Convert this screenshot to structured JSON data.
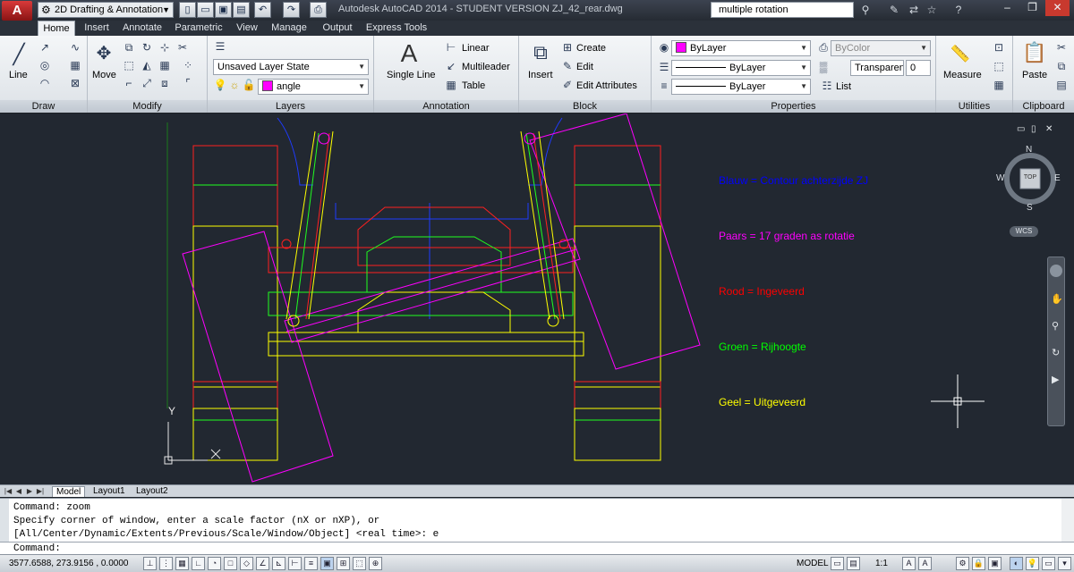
{
  "app": {
    "logo": "A",
    "window_title": "Autodesk AutoCAD 2014 - STUDENT VERSION    ZJ_42_rear.dwg"
  },
  "workspace": {
    "label": "2D Drafting & Annotation"
  },
  "search": {
    "value": "multiple rotation"
  },
  "tabs": [
    "Home",
    "Insert",
    "Annotate",
    "Parametric",
    "View",
    "Manage",
    "Output",
    "Express Tools"
  ],
  "panels": {
    "draw": {
      "title": "Draw",
      "line": "Line"
    },
    "modify": {
      "title": "Modify",
      "move": "Move"
    },
    "layers": {
      "title": "Layers",
      "layer_state": "Unsaved Layer State",
      "current_layer": "angle",
      "layer_color": "#ff00ff"
    },
    "annotation": {
      "title": "Annotation",
      "single_line": "Single Line",
      "linear": "Linear",
      "multileader": "Multileader",
      "table": "Table"
    },
    "block": {
      "title": "Block",
      "insert": "Insert",
      "create": "Create",
      "edit": "Edit",
      "edit_attributes": "Edit Attributes"
    },
    "properties": {
      "title": "Properties",
      "color": "ByLayer",
      "color_swatch": "#ff00ff",
      "plotstyle": "ByColor",
      "linetype": "ByLayer",
      "lineweight": "ByLayer",
      "transparency_label": "Transparen...",
      "transparency_value": "0",
      "list": "List"
    },
    "utilities": {
      "title": "Utilities",
      "measure": "Measure"
    },
    "clipboard": {
      "title": "Clipboard",
      "paste": "Paste"
    }
  },
  "legend": [
    {
      "text": "Blauw = Contour achterzijde ZJ",
      "color": "#0000ff"
    },
    {
      "text": "Paars = 17 graden as rotatie",
      "color": "#ff00ff"
    },
    {
      "text": "Rood = Ingeveerd",
      "color": "#ff0000"
    },
    {
      "text": "Groen = Rijhoogte",
      "color": "#00ff00"
    },
    {
      "text": "Geel = Uitgeveerd",
      "color": "#ffff00"
    }
  ],
  "viewcube": {
    "n": "N",
    "s": "S",
    "e": "E",
    "w": "W",
    "face": "TOP",
    "wcs": "WCS"
  },
  "ucs": {
    "y": "Y"
  },
  "layout_tabs": [
    "Model",
    "Layout1",
    "Layout2"
  ],
  "command": {
    "history": [
      "Command: zoom",
      "Specify corner of window, enter a scale factor (nX or nXP), or",
      "[All/Center/Dynamic/Extents/Previous/Scale/Window/Object] <real time>: e"
    ],
    "prompt": "Command:"
  },
  "status": {
    "coords": "3577.6588, 273.9156 , 0.0000",
    "model": "MODEL",
    "scale": "1:1"
  }
}
